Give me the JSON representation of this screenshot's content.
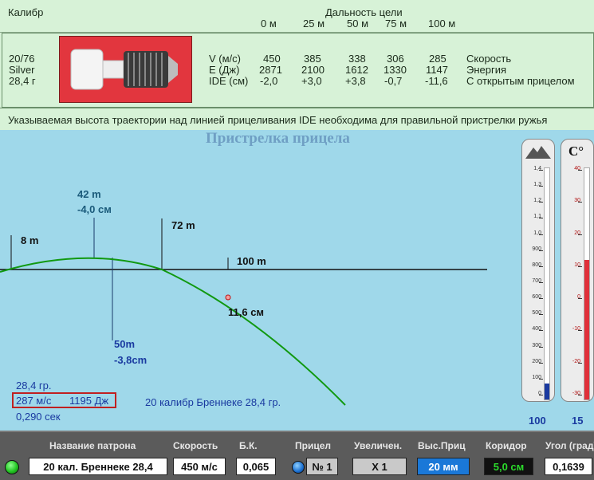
{
  "table": {
    "caliber_header": "Калибр",
    "range_header": "Дальность цели",
    "distances": [
      "0 м",
      "25 м",
      "50 м",
      "75 м",
      "100 м"
    ],
    "cartridge": [
      "20/76",
      "Silver",
      "28,4 г"
    ],
    "row_labels": [
      "V (м/с)",
      "E (Дж)",
      "IDE (см)"
    ],
    "rows": [
      [
        "450",
        "385",
        "338",
        "306",
        "285"
      ],
      [
        "2871",
        "2100",
        "1612",
        "1330",
        "1147"
      ],
      [
        "-2,0",
        "+3,0",
        "+3,8",
        "-0,7",
        "-11,6"
      ]
    ],
    "row_titles": [
      "Скорость",
      "Энергия",
      "С открытым прицелом"
    ],
    "note": "Указываемая высота траектории над линией прицеливания IDE необходима для правильной пристрелки ружья"
  },
  "scene": {
    "title": "Пристрелка прицела",
    "marker_8": "8 m",
    "marker_42_dist": "42 m",
    "marker_42_val": "-4,0 см",
    "marker_72": "72 m",
    "marker_100": "100 m",
    "marker_50_dist": "50m",
    "marker_50_val": "-3,8cm",
    "point_val": "11,6 см",
    "info_weight": "28,4 гр.",
    "info_speed": "287 м/с",
    "info_energy": "1195 Дж",
    "info_time": "0,290 сек",
    "ammo_caption": "20 калибр Бреннеке 28,4 гр.",
    "altitude_value": "100",
    "temp_label": "C°",
    "temp_value": "15",
    "alt_ticks": [
      "1,4",
      "1,3",
      "1,2",
      "1,1",
      "1,0",
      "900",
      "800",
      "700",
      "600",
      "500",
      "400",
      "300",
      "200",
      "100",
      "0"
    ],
    "temp_ticks": [
      "40",
      "30",
      "20",
      "10",
      "0",
      "-10",
      "-20",
      "-30"
    ]
  },
  "bottom": {
    "labels": [
      "Название патрона",
      "Скорость",
      "Б.К.",
      "Прицел",
      "Увеличен.",
      "Выс.Приц",
      "Коридор",
      "Угол (град)"
    ],
    "ammo_name": "20 кал. Бреннеке 28,4",
    "speed": "450 м/с",
    "bc": "0,065",
    "scope": "№ 1",
    "zoom": "X 1",
    "scope_height": "20 мм",
    "corridor": "5,0 см",
    "angle": "0,1639"
  },
  "colors": {
    "trajectory": "#119911",
    "accent_blue": "#1a3aa0",
    "status_green": "#22c522",
    "thermo_red": "#e0303a"
  }
}
